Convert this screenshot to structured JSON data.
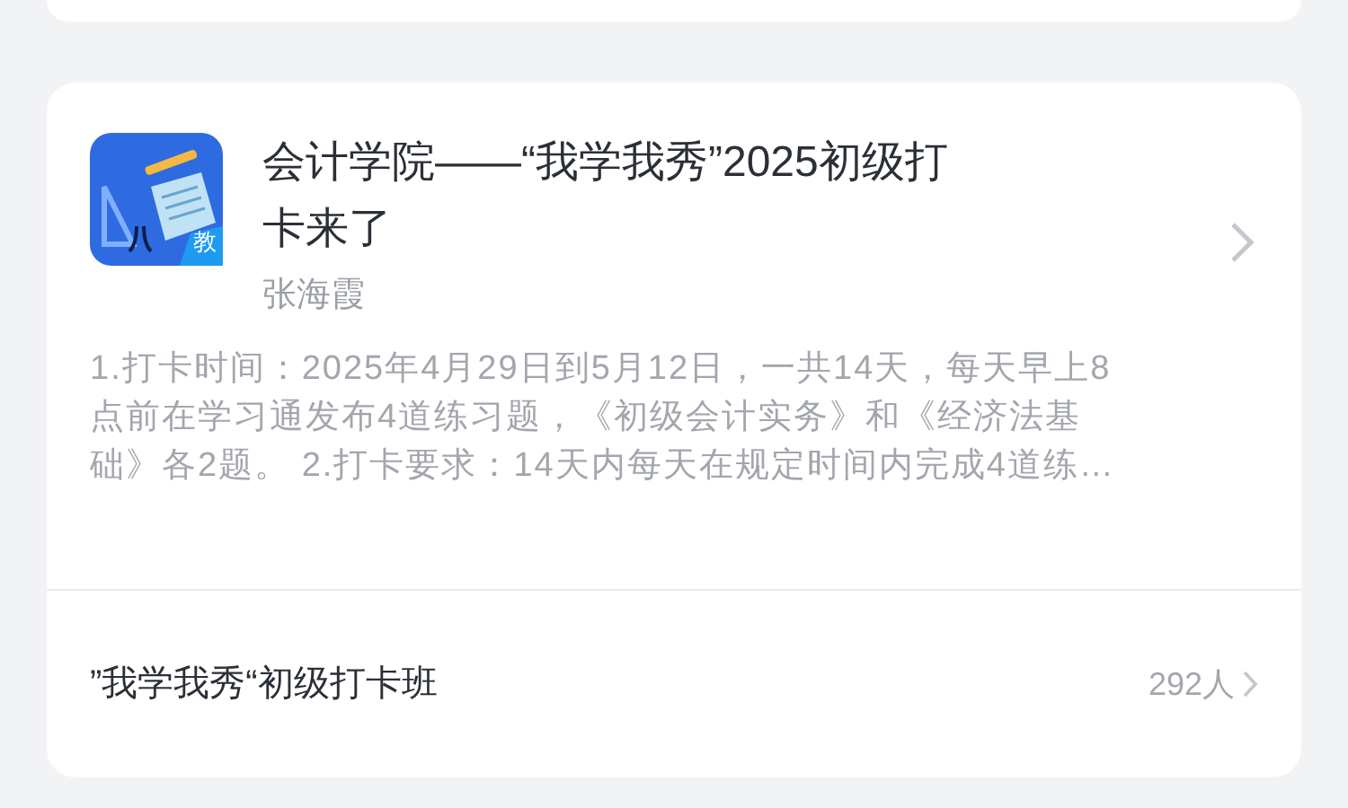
{
  "card": {
    "title": "会计学院——“我学我秀”2025初级打卡来了",
    "author": "张海霞",
    "icon_badge": "教",
    "description": "1.打卡时间：2025年4月29日到5月12日，一共14天，每天早上8点前在学习通发布4道练习题，《初级会计实务》和《经济法基础》各2题。 2.打卡要求：14天内每天在规定时间内完成4道练…"
  },
  "footer": {
    "class_name": "”我学我秀“初级打卡班",
    "member_count": "292人"
  }
}
